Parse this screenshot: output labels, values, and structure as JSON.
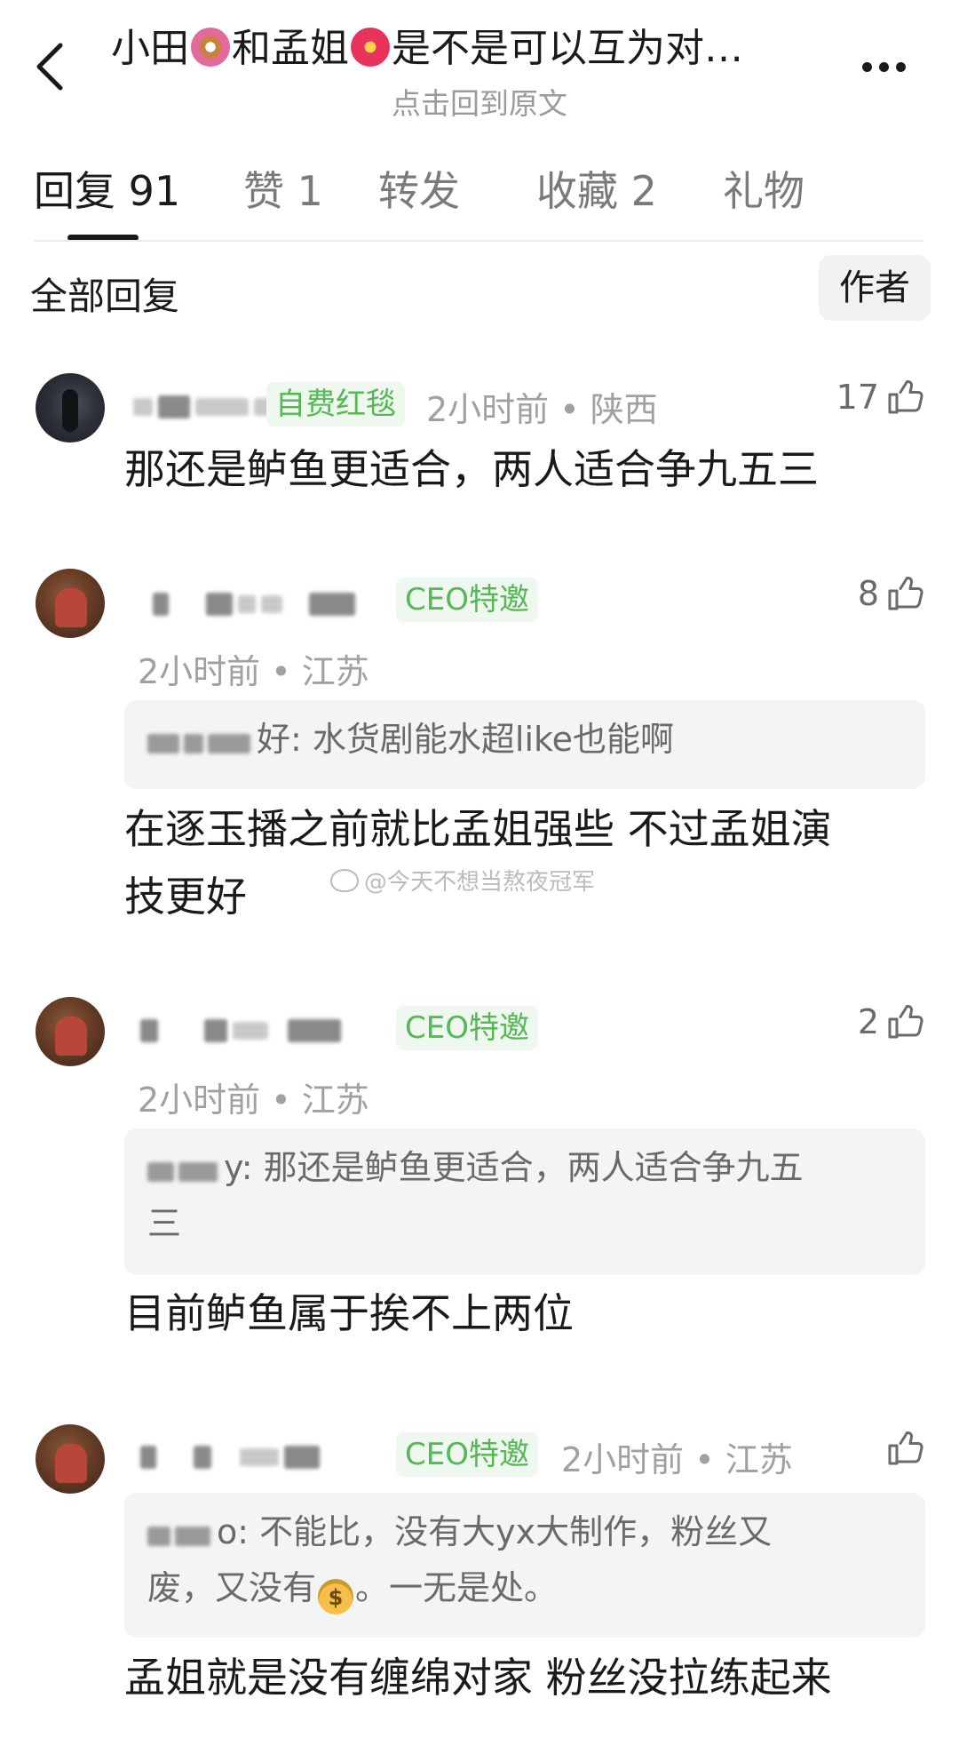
{
  "header": {
    "title_part1": "小田",
    "title_part2": "和孟姐",
    "title_part3": "是不是可以互为对…",
    "emoji_1": "donut-emoji",
    "emoji_2": "hibiscus-emoji",
    "subtitle": "点击回到原文"
  },
  "tabs": [
    {
      "label": "回复 91"
    },
    {
      "label": "赞 1"
    },
    {
      "label": "转发"
    },
    {
      "label": "收藏 2"
    },
    {
      "label": "礼物"
    }
  ],
  "section": {
    "title": "全部回复",
    "author_filter": "作者"
  },
  "watermark": "@今天不想当熬夜冠军",
  "comments": [
    {
      "badge": "自费红毯",
      "meta": "2小时前 • 陕西",
      "likes": "17",
      "text": "那还是鲈鱼更适合，两人适合争九五三"
    },
    {
      "badge": "CEO特邀",
      "meta": "2小时前 • 江苏",
      "likes": "8",
      "quote": "好: 水货剧能水超like也能啊",
      "text_line1": "在逐玉播之前就比孟姐强些 不过孟姐演",
      "text_line2": "技更好"
    },
    {
      "badge": "CEO特邀",
      "meta": "2小时前 • 江苏",
      "likes": "2",
      "quote_line1": "y: 那还是鲈鱼更适合，两人适合争九五",
      "quote_line2": "三",
      "text": "目前鲈鱼属于挨不上两位"
    },
    {
      "badge": "CEO特邀",
      "meta": "2小时前 • 江苏",
      "likes": "",
      "quote_line1": "o: 不能比，没有大yx大制作，粉丝又",
      "quote_line2a": "废，又没有",
      "quote_line2b": "。一无是处。",
      "text": "孟姐就是没有缠绵对家 粉丝没拉练起来"
    }
  ],
  "colors": {
    "badge_green": "#55b755",
    "badge_bg": "#eef8ee",
    "meta_gray": "#a0a0a0",
    "quote_bg": "#f4f4f4"
  }
}
